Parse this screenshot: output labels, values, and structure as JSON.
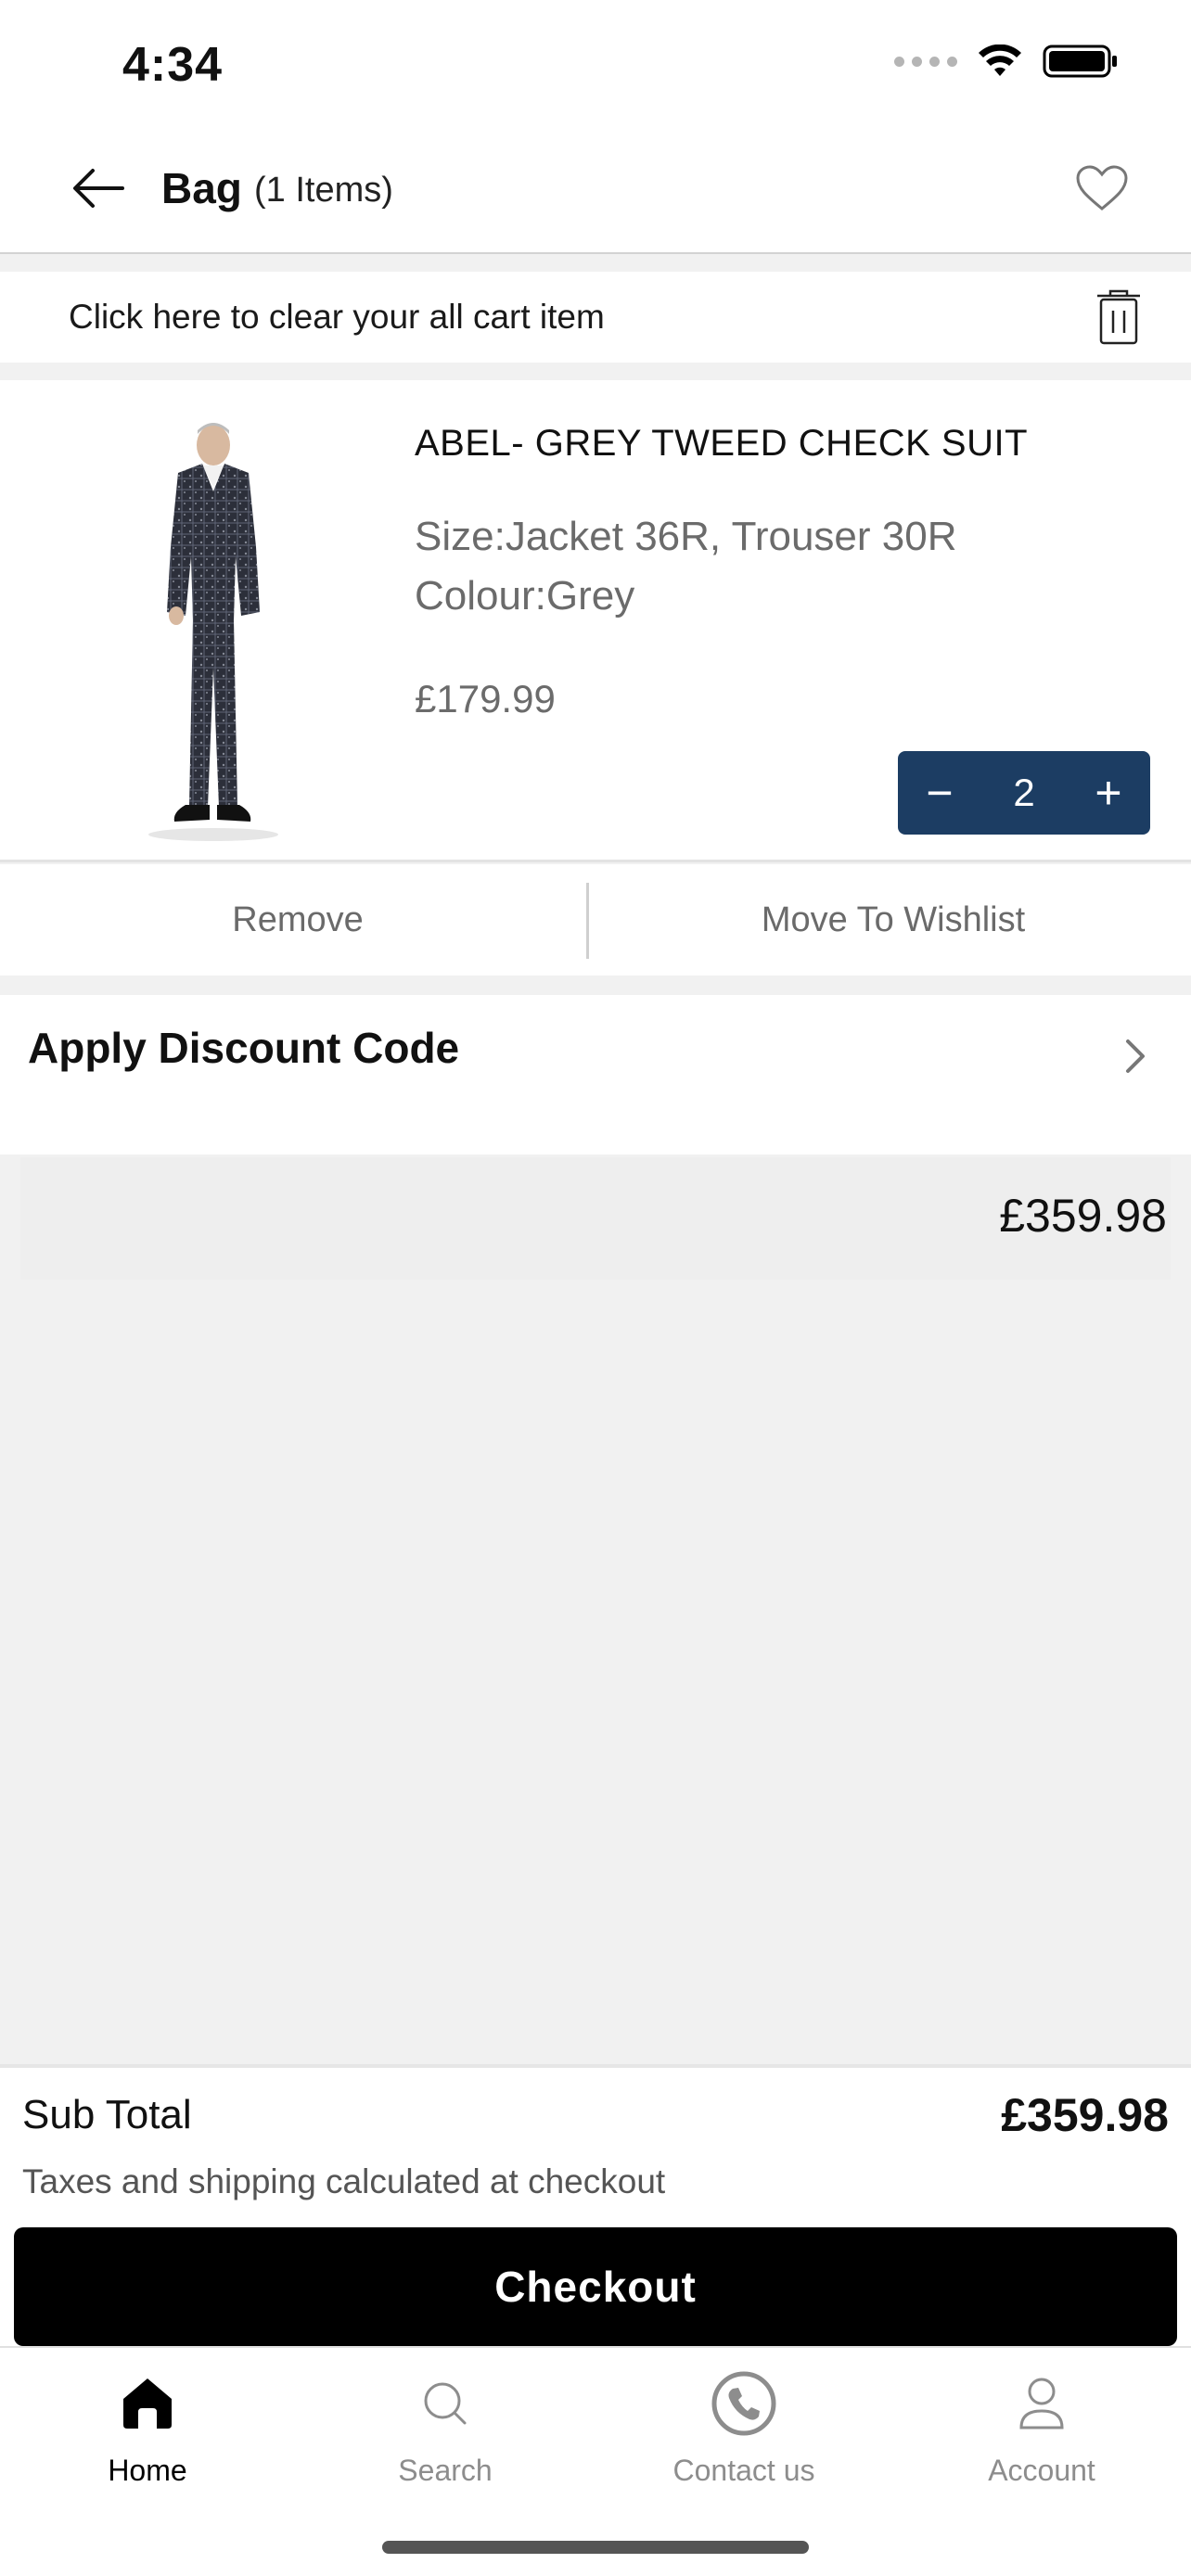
{
  "status_bar": {
    "time": "4:34"
  },
  "header": {
    "title": "Bag",
    "count": "(1 Items)"
  },
  "clear_cart": {
    "label": "Click here to clear your all cart item"
  },
  "cart_item": {
    "name": "ABEL- GREY TWEED CHECK SUIT",
    "size": "Size:Jacket 36R, Trouser 30R",
    "colour": "Colour:Grey",
    "price": "£179.99",
    "quantity": "2",
    "minus": "−",
    "plus": "+"
  },
  "actions": {
    "remove": "Remove",
    "move_to_wishlist": "Move To Wishlist"
  },
  "discount": {
    "label": "Apply Discount Code"
  },
  "total_strip": {
    "value": "£359.98"
  },
  "summary": {
    "subtotal_label": "Sub Total",
    "subtotal_value": "£359.98",
    "tax_note": "Taxes and shipping calculated at checkout",
    "checkout_label": "Checkout"
  },
  "tabs": [
    {
      "label": "Home",
      "icon": "home-icon",
      "active": true
    },
    {
      "label": "Search",
      "icon": "search-icon",
      "active": false
    },
    {
      "label": "Contact us",
      "icon": "phone-icon",
      "active": false
    },
    {
      "label": "Account",
      "icon": "account-icon",
      "active": false
    }
  ],
  "colors": {
    "accent": "#1c3d63",
    "checkout": "#000000",
    "background": "#f1f1f1"
  }
}
